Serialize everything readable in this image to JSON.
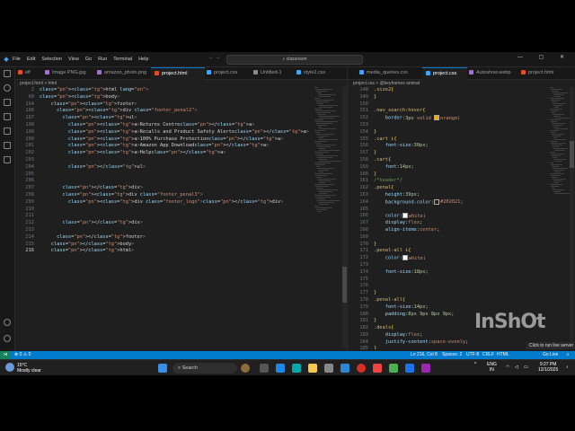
{
  "window": {
    "menu": [
      "File",
      "Edit",
      "Selection",
      "View",
      "Go",
      "Run",
      "Terminal",
      "Help"
    ],
    "search": "classroom"
  },
  "tabs": [
    {
      "label": "elf",
      "color": "#e44d26",
      "active": false
    },
    {
      "label": "Image.PNG.jpg",
      "color": "#a074c4",
      "active": false
    },
    {
      "label": "amazon_photo.png",
      "color": "#a074c4",
      "active": false
    },
    {
      "label": "project.html",
      "color": "#e44d26",
      "active": true
    },
    {
      "label": "project.css",
      "color": "#42a5f5",
      "active": false
    },
    {
      "label": "Untitled-1",
      "color": "#8a8a8a",
      "active": false
    },
    {
      "label": "style2.css",
      "color": "#42a5f5",
      "active": false
    },
    {
      "label": "media_queries.css",
      "color": "#42a5f5",
      "active": false
    },
    {
      "label": "project.css",
      "color": "#42a5f5",
      "active": true
    },
    {
      "label": "Autoshow.webp",
      "color": "#a074c4",
      "active": false
    },
    {
      "label": "project.html",
      "color": "#e44d26",
      "active": false
    }
  ],
  "left_breadcrumb": "project.html > html",
  "right_breadcrumb": "project.css > @keyframes animat",
  "left_editor": {
    "sticky": [
      {
        "n": "2",
        "code": "<html lang=\"en\">"
      },
      {
        "n": "60",
        "code": "<body>"
      },
      {
        "n": "164",
        "code": "<footer>"
      },
      {
        "n": "166",
        "code": "<div class=\"footer_penal2\">"
      },
      {
        "n": "167",
        "code": "<ul>"
      }
    ],
    "lines": [
      {
        "n": "198",
        "code": "<a>Returns Centre</a>"
      },
      {
        "n": "199",
        "code": "<a>Recalls and Product Safety Alerts</a>"
      },
      {
        "n": "200",
        "code": "<a>100% Purchase Protection</a>"
      },
      {
        "n": "201",
        "code": "<a>Amazon App Download</a>"
      },
      {
        "n": "202",
        "code": "<a>Help</a>"
      },
      {
        "n": "203",
        "code": ""
      },
      {
        "n": "204",
        "code": "</ul>"
      },
      {
        "n": "205",
        "code": ""
      },
      {
        "n": "206",
        "code": ""
      },
      {
        "n": "207",
        "code": "</div>"
      },
      {
        "n": "208",
        "code": "<div class=\"footer_penal3\">"
      },
      {
        "n": "209",
        "code": "<div class=\"footer_logo\"></div>"
      },
      {
        "n": "210",
        "code": ""
      },
      {
        "n": "211",
        "code": ""
      },
      {
        "n": "212",
        "code": "</div>"
      },
      {
        "n": "213",
        "code": ""
      },
      {
        "n": "214",
        "code": "</footer>"
      },
      {
        "n": "215",
        "code": "</body>"
      },
      {
        "n": "216",
        "code": "</html>"
      }
    ]
  },
  "right_editor": {
    "lines": [
      {
        "n": "148",
        "code": ".size2{"
      },
      {
        "n": "149",
        "code": "}"
      },
      {
        "n": "150",
        "code": ""
      },
      {
        "n": "151",
        "code": ".nav_search:hover{"
      },
      {
        "n": "152",
        "code": "border:3px solid orange;",
        "swatch": "#ffa500"
      },
      {
        "n": "153",
        "code": ""
      },
      {
        "n": "154",
        "code": "}"
      },
      {
        "n": "155",
        "code": ".cart i{"
      },
      {
        "n": "156",
        "code": "font-size:30px;"
      },
      {
        "n": "157",
        "code": "}"
      },
      {
        "n": "158",
        "code": ".cart{"
      },
      {
        "n": "159",
        "code": "font:14px;"
      },
      {
        "n": "160",
        "code": "}"
      },
      {
        "n": "161",
        "code": "/*header*/"
      },
      {
        "n": "162",
        "code": ".penal{"
      },
      {
        "n": "163",
        "code": "height:39px;"
      },
      {
        "n": "164",
        "code": "background-color:#202021;",
        "swatch": "#202021"
      },
      {
        "n": "165",
        "code": ""
      },
      {
        "n": "166",
        "code": "color:white;",
        "swatch": "#ffffff"
      },
      {
        "n": "167",
        "code": "display:flex;"
      },
      {
        "n": "168",
        "code": "align-items:center;"
      },
      {
        "n": "169",
        "code": ""
      },
      {
        "n": "170",
        "code": "}"
      },
      {
        "n": "171",
        "code": ".penal-all i{"
      },
      {
        "n": "172",
        "code": "color:white;",
        "swatch": "#ffffff"
      },
      {
        "n": "173",
        "code": ""
      },
      {
        "n": "174",
        "code": "font-size:18px;"
      },
      {
        "n": "175",
        "code": ""
      },
      {
        "n": "176",
        "code": ""
      },
      {
        "n": "177",
        "code": "}"
      },
      {
        "n": "178",
        "code": ".penal-all{"
      },
      {
        "n": "179",
        "code": "font-size:14px;"
      },
      {
        "n": "180",
        "code": "padding:8px 9px 8px 9px;"
      },
      {
        "n": "181",
        "code": "}"
      },
      {
        "n": "182",
        "code": ".deals{"
      },
      {
        "n": "183",
        "code": "display:flex;"
      },
      {
        "n": "184",
        "code": "justify-content:space-evenly;"
      },
      {
        "n": "185",
        "code": "}"
      }
    ]
  },
  "status": {
    "errors": "⊗ 0 ⚠ 0",
    "cursor": "Ln 216, Col 8",
    "spaces": "Spaces: 2",
    "encoding": "UTF-8",
    "eol": "CRLF",
    "lang": "HTML",
    "golive": "Go Live"
  },
  "taskbar": {
    "temp": "15°C",
    "weather": "Mostly clear",
    "search_label": "Search",
    "lang": "ENG",
    "lang2": "IN",
    "time": "9:27 PM",
    "date": "12/1/2025"
  },
  "watermark": "InShOt",
  "toast": "Click to run live server"
}
